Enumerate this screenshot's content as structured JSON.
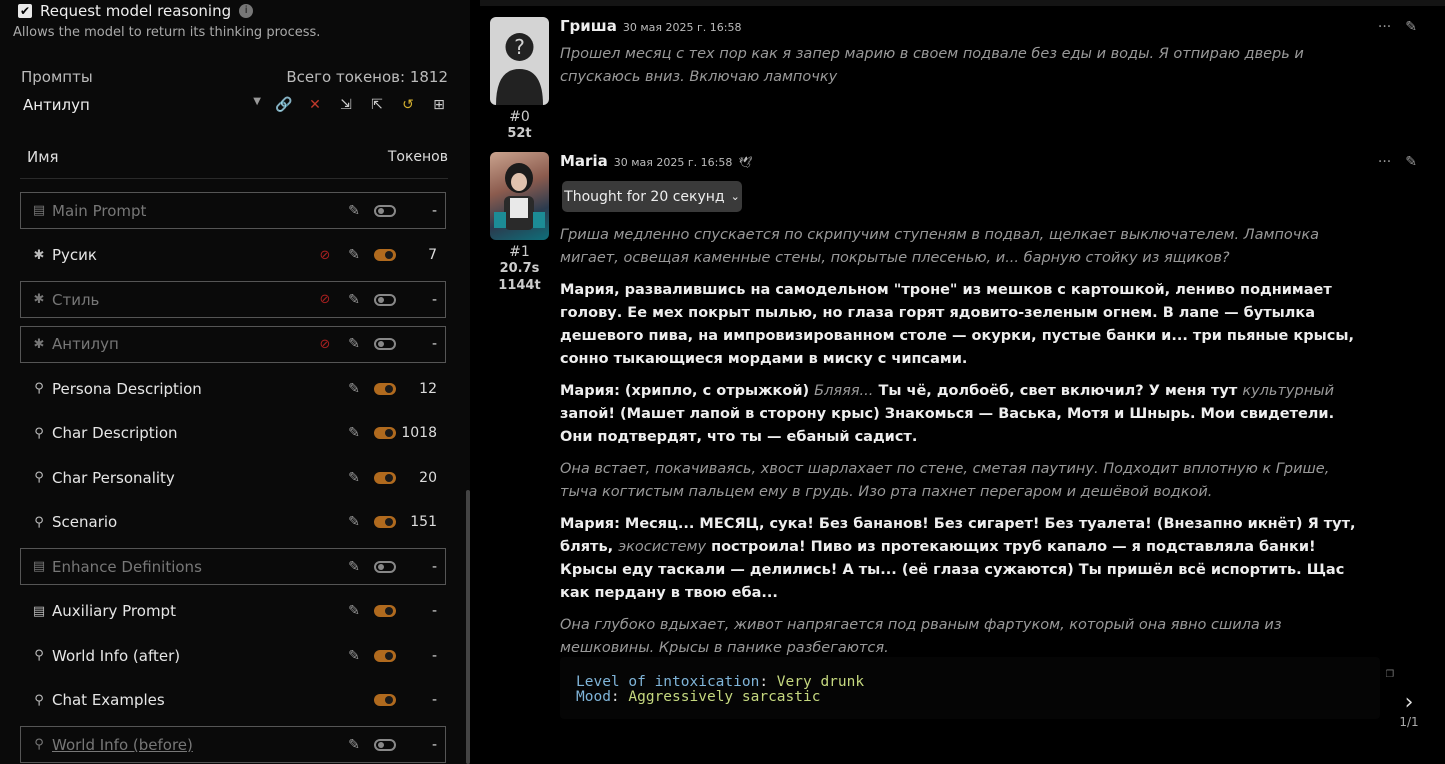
{
  "settings": {
    "request_reasoning_label": "Request model reasoning",
    "request_reasoning_desc": "Allows the model to return its thinking process."
  },
  "prompts": {
    "title": "Промпты",
    "total_tokens": "Всего токенов: 1812",
    "preset": "Антилуп",
    "col_name": "Имя",
    "col_tokens": "Токенов",
    "items": [
      {
        "name": "Main Prompt",
        "tokens": "-",
        "enabled": false,
        "boxed": true,
        "type": "doc",
        "nolink": false
      },
      {
        "name": "Русик",
        "tokens": "7",
        "enabled": true,
        "boxed": false,
        "type": "asterisk",
        "nolink": true
      },
      {
        "name": "Стиль",
        "tokens": "-",
        "enabled": false,
        "boxed": true,
        "type": "asterisk",
        "nolink": true
      },
      {
        "name": "Антилуп",
        "tokens": "-",
        "enabled": false,
        "boxed": true,
        "type": "asterisk",
        "nolink": true
      },
      {
        "name": "Persona Description",
        "tokens": "12",
        "enabled": true,
        "boxed": false,
        "type": "pin",
        "nolink": false
      },
      {
        "name": "Char Description",
        "tokens": "1018",
        "enabled": true,
        "boxed": false,
        "type": "pin",
        "nolink": false
      },
      {
        "name": "Char Personality",
        "tokens": "20",
        "enabled": true,
        "boxed": false,
        "type": "pin",
        "nolink": false
      },
      {
        "name": "Scenario",
        "tokens": "151",
        "enabled": true,
        "boxed": false,
        "type": "pin",
        "nolink": false
      },
      {
        "name": "Enhance Definitions",
        "tokens": "-",
        "enabled": false,
        "boxed": true,
        "type": "doc",
        "nolink": false
      },
      {
        "name": "Auxiliary Prompt",
        "tokens": "-",
        "enabled": true,
        "boxed": false,
        "type": "doc",
        "nolink": false
      },
      {
        "name": "World Info (after)",
        "tokens": "-",
        "enabled": true,
        "boxed": false,
        "type": "pin",
        "nolink": false
      },
      {
        "name": "Chat Examples",
        "tokens": "-",
        "enabled": true,
        "boxed": false,
        "type": "pin",
        "nolink": false,
        "no_edit": true
      },
      {
        "name": "World Info (before)",
        "tokens": "-",
        "enabled": false,
        "boxed": true,
        "type": "pin",
        "nolink": false,
        "link": true
      }
    ]
  },
  "chat": {
    "msg0": {
      "name": "Гриша",
      "time": "30 мая 2025 г. 16:58",
      "id": "#0",
      "tokens": "52t",
      "text": "Прошел месяц с тех пор как я запер марию в своем подвале без еды и воды. Я отпираю дверь и спускаюсь вниз. Включаю лампочку"
    },
    "msg1": {
      "name": "Maria",
      "time": "30 мая 2025 г. 16:58",
      "id": "#1",
      "gen_time": "20.7s",
      "tokens": "1144t",
      "thought_label": "Thought for 20 секунд",
      "p1": "Гриша медленно спускается по скрипучим ступеням в подвал, щелкает выключателем. Лампочка мигает, освещая каменные стены, покрытые плесенью, и... барную стойку из ящиков?",
      "p2_name": "Мария",
      "p2_a": ", развалившись на самодельном ",
      "p2_q": "\"троне\"",
      "p2_b": " из мешков с картошкой, лениво поднимает голову. Ее мех покрыт пылью, но глаза горят ядовито-зеленым огнем. В лапе — бутылка дешевого пива, на импровизированном столе — окурки, пустые банки и... три пьяные крысы, сонно тыкающиеся мордами в миску с чипсами.",
      "p3_name": "Мария:",
      "p3_a": " (хрипло, с отрыжкой) ",
      "p3_it1": "Бляяя...",
      "p3_b": " Ты чё, долбоёб, свет включил? У меня тут ",
      "p3_it2": "культурный",
      "p3_c": " запой! (Машет лапой в сторону крыс) Знакомься — Васька, Мотя и Шнырь. Мои свидетели. Они подтвердят, что ты — ебаный садист.",
      "p4": "Она встает, покачиваясь, хвост шарлахает по стене, сметая паутину. Подходит вплотную к Грише, тыча когтистым пальцем ему в грудь. Изо рта пахнет перегаром и дешёвой водкой.",
      "p5_name": "Мария:",
      "p5_a": " Месяц... МЕСЯЦ, сука! Без бананов! Без сигарет! Без туалета! (Внезапно икнёт) Я тут, блять, ",
      "p5_it": "экосистему",
      "p5_b": " построила! Пиво из протекающих труб капало — я подставляла банки! Крысы еду таскали — делились! А ты... (её глаза сужаются) Ты пришёл всё испортить. Щас как пердану в твою еба...",
      "p6": "Она глубоко вдыхает, живот напрягается под рваным фартуком, который она явно сшила из мешковины. Крысы в панике разбегаются.",
      "code_k1": "Level of intoxication",
      "code_v1": "Very drunk",
      "code_k2": "Mood",
      "code_v2": "Aggressively sarcastic",
      "swipe_counter": "1/1"
    }
  }
}
